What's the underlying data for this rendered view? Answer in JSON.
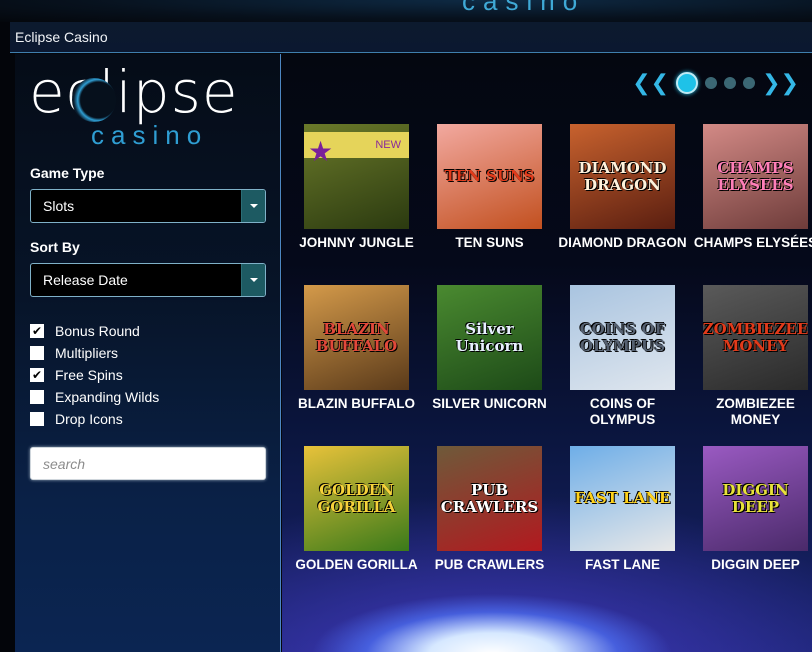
{
  "header": {
    "logo_peek": "casino",
    "title": "Eclipse Casino"
  },
  "sidebar": {
    "logo": {
      "word": "eclipse",
      "sub": "casino"
    },
    "game_type": {
      "label": "Game Type",
      "value": "Slots"
    },
    "sort_by": {
      "label": "Sort By",
      "value": "Release Date"
    },
    "filters": [
      {
        "label": "Bonus Round",
        "checked": true
      },
      {
        "label": "Multipliers",
        "checked": false
      },
      {
        "label": "Free Spins",
        "checked": true
      },
      {
        "label": "Expanding Wilds",
        "checked": false
      },
      {
        "label": "Drop Icons",
        "checked": false
      }
    ],
    "search": {
      "placeholder": "search",
      "value": ""
    }
  },
  "pager": {
    "prev_icon": "chevron-left-icon",
    "next_icon": "chevron-right-icon",
    "pages": 4,
    "current": 1
  },
  "games": [
    {
      "name": "JOHNNY JUNGLE",
      "art": "",
      "badge": "NEW",
      "colors": [
        "#6b7a2a",
        "#2b3a10"
      ],
      "art_color": "#fff"
    },
    {
      "name": "TEN SUNS",
      "art": "TEN SUNS",
      "colors": [
        "#f2a9a0",
        "#c2501f"
      ],
      "art_color": "#e23a1a"
    },
    {
      "name": "DIAMOND DRAGON",
      "art": "DIAMOND DRAGON",
      "colors": [
        "#c8622e",
        "#5a1e10"
      ],
      "art_color": "#fff2dc"
    },
    {
      "name": "CHAMPS ELYSÉES",
      "art": "CHAMPS ELYSEES",
      "colors": [
        "#d38a86",
        "#6e3c3a"
      ],
      "art_color": "#ff7fb8"
    },
    {
      "name": "BLAZIN BUFFALO",
      "art": "BLAZIN BUFFALO",
      "colors": [
        "#d49a4a",
        "#5a3a1a"
      ],
      "art_color": "#e2483a"
    },
    {
      "name": "SILVER UNICORN",
      "art": "Silver Unicorn",
      "colors": [
        "#4a8a30",
        "#1d4a18"
      ],
      "art_color": "#e8f0ff"
    },
    {
      "name": "COINS OF OLYMPUS",
      "art": "COINS OF OLYMPUS",
      "colors": [
        "#a9c4e0",
        "#dfe6ee"
      ],
      "art_color": "#556070"
    },
    {
      "name": "ZOMBIEZEE MONEY",
      "art": "ZOMBIEZEE MONEY",
      "colors": [
        "#5a5a5a",
        "#2a2a2a"
      ],
      "art_color": "#e23a1a"
    },
    {
      "name": "GOLDEN GORILLA",
      "art": "GOLDEN GORILLA",
      "colors": [
        "#e8c23a",
        "#3a7a1a"
      ],
      "art_color": "#f6d23a"
    },
    {
      "name": "PUB CRAWLERS",
      "art": "PUB CRAWLERS",
      "colors": [
        "#6e5a3a",
        "#b2191f"
      ],
      "art_color": "#ffffff"
    },
    {
      "name": "FAST LANE",
      "art": "FAST LANE",
      "colors": [
        "#6eaee8",
        "#e8e8e8"
      ],
      "art_color": "#ffd21a"
    },
    {
      "name": "DIGGIN DEEP",
      "art": "DIGGIN DEEP",
      "colors": [
        "#9a5ac2",
        "#4a2a6a"
      ],
      "art_color": "#e8e23a"
    }
  ]
}
